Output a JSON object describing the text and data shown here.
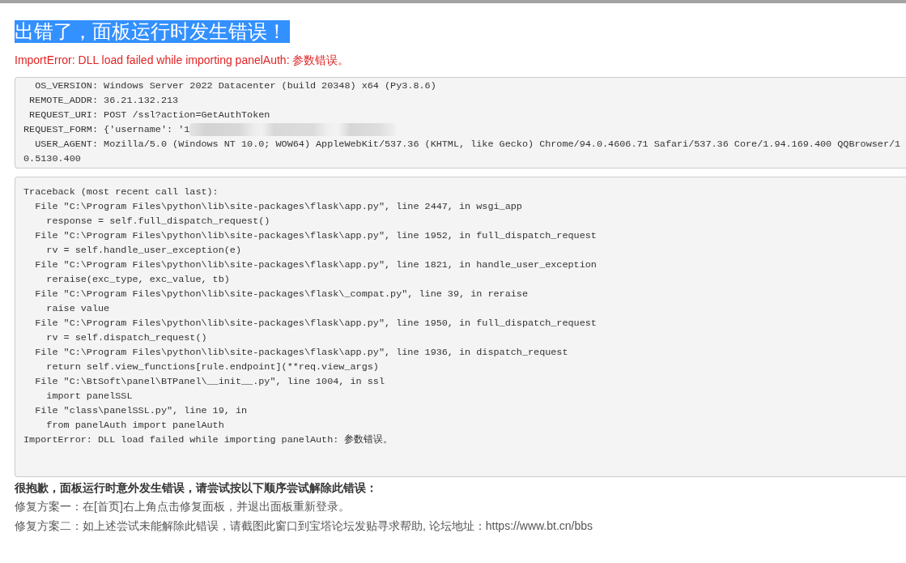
{
  "title": {
    "text": "出错了，面板运行时发生错误！",
    "highlighted": true
  },
  "error_message": "ImportError: DLL load failed while importing panelAuth: 参数错误。",
  "request_info": {
    "lines": [
      {
        "text": "  OS_VERSION: Windows Server 2022 Datacenter (build 20348) x64 (Py3.8.6)",
        "redacted": false
      },
      {
        "text": " REMOTE_ADDR: 36.21.132.213",
        "redacted": false
      },
      {
        "text": " REQUEST_URI: POST /ssl?action=GetAuthToken",
        "redacted": false
      },
      {
        "text": "REQUEST_FORM: {'username': '1",
        "redacted": true
      },
      {
        "text": "  USER_AGENT: Mozilla/5.0 (Windows NT 10.0; WOW64) AppleWebKit/537.36 (KHTML, like Gecko) Chrome/94.0.4606.71 Safari/537.36 Core/1.94.169.400 QQBrowser/1",
        "redacted": false
      },
      {
        "text": "0.5130.400",
        "redacted": false
      }
    ]
  },
  "traceback": {
    "lines": [
      "Traceback (most recent call last):",
      "  File \"C:\\Program Files\\python\\lib\\site-packages\\flask\\app.py\", line 2447, in wsgi_app",
      "    response = self.full_dispatch_request()",
      "  File \"C:\\Program Files\\python\\lib\\site-packages\\flask\\app.py\", line 1952, in full_dispatch_request",
      "    rv = self.handle_user_exception(e)",
      "  File \"C:\\Program Files\\python\\lib\\site-packages\\flask\\app.py\", line 1821, in handle_user_exception",
      "    reraise(exc_type, exc_value, tb)",
      "  File \"C:\\Program Files\\python\\lib\\site-packages\\flask\\_compat.py\", line 39, in reraise",
      "    raise value",
      "  File \"C:\\Program Files\\python\\lib\\site-packages\\flask\\app.py\", line 1950, in full_dispatch_request",
      "    rv = self.dispatch_request()",
      "  File \"C:\\Program Files\\python\\lib\\site-packages\\flask\\app.py\", line 1936, in dispatch_request",
      "    return self.view_functions[rule.endpoint](**req.view_args)",
      "  File \"C:\\BtSoft\\panel\\BTPanel\\__init__.py\", line 1004, in ssl",
      "    import panelSSL",
      "  File \"class\\panelSSL.py\", line 19, in",
      "    from panelAuth import panelAuth",
      "ImportError: DLL load failed while importing panelAuth: 参数错误。"
    ]
  },
  "help": {
    "heading": "很抱歉，面板运行时意外发生错误，请尝试按以下顺序尝试解除此错误：",
    "steps": [
      "修复方案一：在[首页]右上角点击修复面板，并退出面板重新登录。",
      "修复方案二：如上述尝试未能解除此错误，请截图此窗口到宝塔论坛发贴寻求帮助, 论坛地址：https://www.bt.cn/bbs"
    ]
  }
}
